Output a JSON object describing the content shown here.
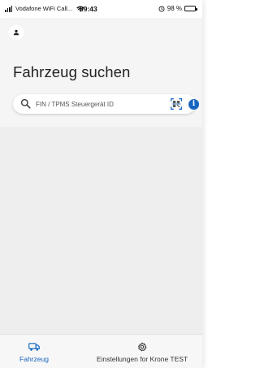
{
  "status_bar": {
    "carrier": "Vodafone WiFi Call...",
    "time": "09:43",
    "battery": "98 %"
  },
  "header": {
    "title": "Fahrzeug suchen"
  },
  "search": {
    "placeholder": "FIN / TPMS Steuergerät ID",
    "value": ""
  },
  "icons": {
    "profile": "person-icon",
    "search": "search-icon",
    "scan": "qr-scan-icon",
    "info": "info-icon",
    "vehicle_tab": "truck-icon",
    "settings_tab": "gear-icon"
  },
  "tabs": [
    {
      "label": "Fahrzeug",
      "active": true
    },
    {
      "label": "Einstellungen for Krone TEST",
      "active": false
    }
  ],
  "colors": {
    "accent": "#1565c0",
    "header_bg": "#f5f5f5",
    "body_bg": "#eeeeee"
  }
}
